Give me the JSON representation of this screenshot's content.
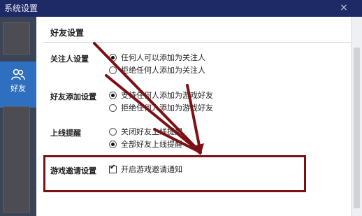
{
  "window": {
    "title": "系统设置",
    "close_label": "×"
  },
  "sidebar": {
    "nav_item": {
      "label": "好友",
      "icon": "friends-icon"
    }
  },
  "section": {
    "title": "好友设置"
  },
  "groups": [
    {
      "label": "关注人设置",
      "options": [
        {
          "text": "任何人可以添加为关注人",
          "selected": true
        },
        {
          "text": "拒绝任何人添加为关注人",
          "selected": false
        }
      ]
    },
    {
      "label": "好友添加设置",
      "options": [
        {
          "text": "支持任何人添加为游戏好友",
          "selected": true
        },
        {
          "text": "拒绝任何人添加为游戏好友",
          "selected": false
        }
      ]
    },
    {
      "label": "上线提醒",
      "options": [
        {
          "text": "关闭好友上线提醒",
          "selected": false
        },
        {
          "text": "全部好友上线提醒",
          "selected": true
        }
      ]
    },
    {
      "label": "游戏邀请设置",
      "options": [
        {
          "text": "开启游戏邀请通知",
          "checked": true
        }
      ]
    }
  ],
  "colors": {
    "titlebar": "#1e2a66",
    "sidebar": "#3c4556",
    "nav_active": "#2f6fbf",
    "annotation": "#7b1114"
  }
}
